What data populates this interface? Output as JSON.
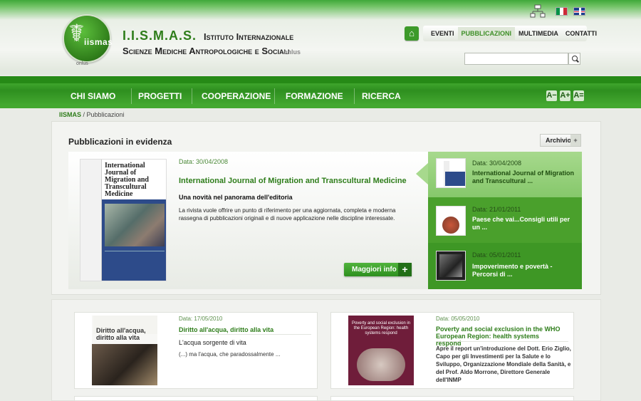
{
  "header": {
    "logo_text": "iismas",
    "logo_onlus": "onlus",
    "site_name": "I.I.S.M.A.S.",
    "site_name_tail": "Istituto Internazionale",
    "site_subtitle": "Scienze Mediche Antropologiche e Sociali",
    "site_onlus": "onlus",
    "top_nav": [
      "EVENTI",
      "PUBBLICAZIONI",
      "MULTIMEDIA",
      "CONTATTI"
    ],
    "search_placeholder": ""
  },
  "main_nav": [
    "CHI SIAMO",
    "PROGETTI",
    "COOPERAZIONE",
    "FORMAZIONE",
    "RICERCA"
  ],
  "font_controls": [
    "A−",
    "A+",
    "A="
  ],
  "breadcrumb": {
    "root": "IISMAS",
    "sep": " / ",
    "current": "Pubblicazioni"
  },
  "featured": {
    "section_title": "Pubblicazioni in evidenza",
    "archive_label": "Archivio",
    "date": "Data: 30/04/2008",
    "title": "International Journal of Migration and Transcultural Medicine",
    "subtitle": "Una novità nel panorama dell'editoria",
    "body": "La rivista vuole offrire un punto di riferimento per una aggiornata, completa e moderna rassegna di pubblicazioni originali e di nuove applicazione nelle discipline interessate.",
    "more_label": "Maggiori info",
    "cover_title": "International Journal of Migration and Transcultural Medicine"
  },
  "side_items": [
    {
      "date": "Data: 30/04/2008",
      "title": "International Journal of Migration and Transcultural ..."
    },
    {
      "date": "Data: 21/01/2011",
      "title": "Paese che vai...Consigli utili per un ..."
    },
    {
      "date": "Data: 05/01/2011",
      "title": "Impoverimento e povertà - Percorsi di ..."
    }
  ],
  "cards": [
    {
      "date": "Data: 17/05/2010",
      "title": "Diritto all'acqua, diritto alla vita",
      "subtitle": "L'acqua sorgente di vita",
      "text": "(...) ma l'acqua, che paradossalmente ...",
      "cover_title": "Diritto all'acqua, diritto alla vita"
    },
    {
      "date": "Data: 05/05/2010",
      "title": "Poverty and social exclusion in the WHO European Region: health systems respond",
      "body": "Apre il report un'introduzione del Dott. Erio Ziglio, Capo per gli Investimenti per la Salute e lo Sviluppo, Organizzazione Mondiale della Sanità, e del Prof. Aldo Morrone, Direttore Generale dell'INMP",
      "cover_title": "Poverty and social exclusion in the European Region: health systems respond"
    }
  ]
}
